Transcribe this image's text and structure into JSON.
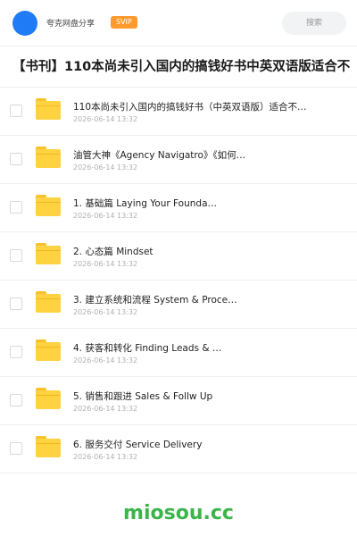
{
  "header": {
    "username": "夸克网盘分享",
    "vip_label": "SVIP",
    "search_label": "搜索"
  },
  "share_title": "【书刊】110本尚未引入国内的搞钱好书中英双语版适合不",
  "files": [
    {
      "name": "110本尚未引入国内的搞钱好书（中英双语版）适合不…",
      "date": "2026-06-14 13:32"
    },
    {
      "name": "油管大神《Agency Navigatro》《如何…",
      "date": "2026-06-14 13:32"
    },
    {
      "name": "1. 基础篇 Laying Your Founda…",
      "date": "2026-06-14 13:32"
    },
    {
      "name": "2. 心态篇 Mindset",
      "date": "2026-06-14 13:32"
    },
    {
      "name": "3. 建立系统和流程 System & Proce…",
      "date": "2026-06-14 13:32"
    },
    {
      "name": "4. 获客和转化 Finding Leads & …",
      "date": "2026-06-14 13:32"
    },
    {
      "name": "5. 销售和跟进 Sales & Follw Up",
      "date": "2026-06-14 13:32"
    },
    {
      "name": "6. 服务交付 Service Delivery",
      "date": "2026-06-14 13:32"
    }
  ],
  "watermark": "miosou.cc",
  "colors": {
    "accent": "#1f7cf6",
    "vip": "#ff9a2e",
    "folder": "#ffd23f",
    "watermark": "#3bb54a"
  }
}
